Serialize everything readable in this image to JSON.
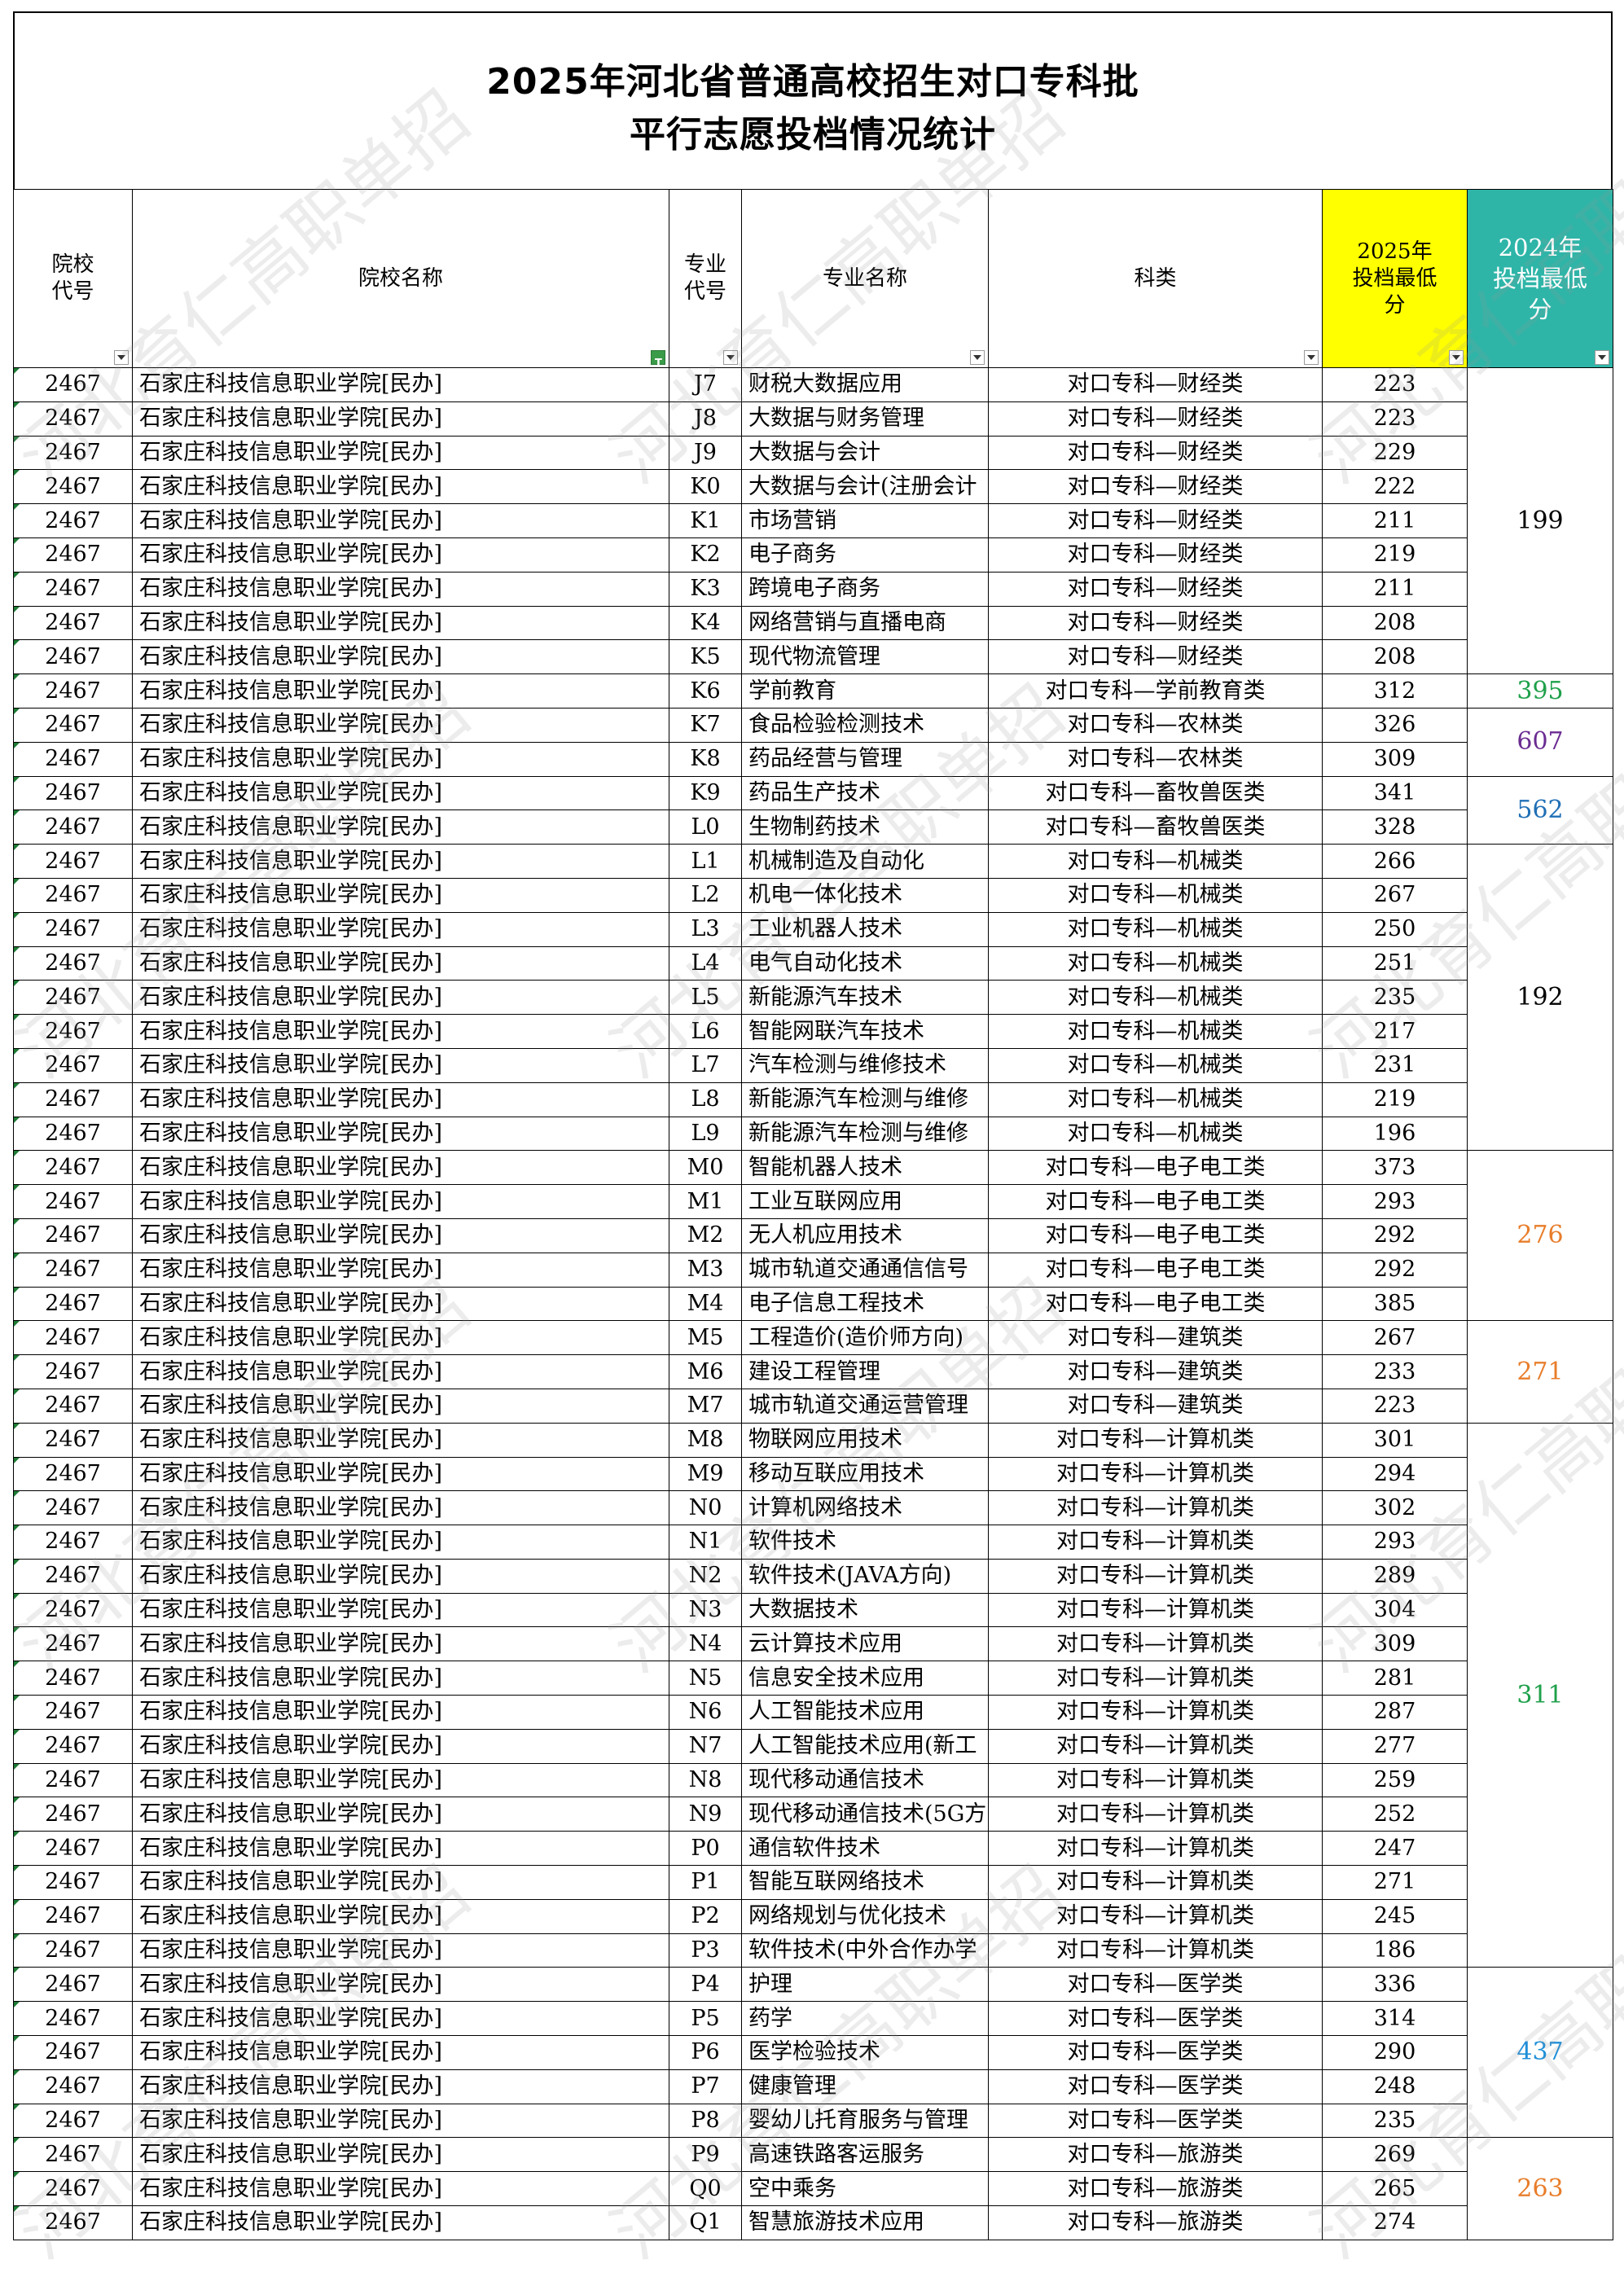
{
  "title": {
    "line1": "2025年河北省普通高校招生对口专科批",
    "line2": "平行志愿投档情况统计"
  },
  "columns": {
    "school_code": "院校代号",
    "school_name": "院校名称",
    "major_code": "专业代号",
    "major_name": "专业名称",
    "category": "科类",
    "score_2025": "2025年投档最低分",
    "score_2024": "2024年投档最低分"
  },
  "watermark": "河北育仁高职单招",
  "school": {
    "code": "2467",
    "name": "石家庄科技信息职业学院[民办]"
  },
  "rows": [
    {
      "mc": "J7",
      "mn": "财税大数据应用",
      "cat": "对口专科—财经类",
      "s": "223"
    },
    {
      "mc": "J8",
      "mn": "大数据与财务管理",
      "cat": "对口专科—财经类",
      "s": "223"
    },
    {
      "mc": "J9",
      "mn": "大数据与会计",
      "cat": "对口专科—财经类",
      "s": "229"
    },
    {
      "mc": "K0",
      "mn": "大数据与会计(注册会计",
      "cat": "对口专科—财经类",
      "s": "222"
    },
    {
      "mc": "K1",
      "mn": "市场营销",
      "cat": "对口专科—财经类",
      "s": "211"
    },
    {
      "mc": "K2",
      "mn": "电子商务",
      "cat": "对口专科—财经类",
      "s": "219"
    },
    {
      "mc": "K3",
      "mn": "跨境电子商务",
      "cat": "对口专科—财经类",
      "s": "211"
    },
    {
      "mc": "K4",
      "mn": "网络营销与直播电商",
      "cat": "对口专科—财经类",
      "s": "208"
    },
    {
      "mc": "K5",
      "mn": "现代物流管理",
      "cat": "对口专科—财经类",
      "s": "208"
    },
    {
      "mc": "K6",
      "mn": "学前教育",
      "cat": "对口专科—学前教育类",
      "s": "312"
    },
    {
      "mc": "K7",
      "mn": "食品检验检测技术",
      "cat": "对口专科—农林类",
      "s": "326"
    },
    {
      "mc": "K8",
      "mn": "药品经营与管理",
      "cat": "对口专科—农林类",
      "s": "309"
    },
    {
      "mc": "K9",
      "mn": "药品生产技术",
      "cat": "对口专科—畜牧兽医类",
      "s": "341"
    },
    {
      "mc": "L0",
      "mn": "生物制药技术",
      "cat": "对口专科—畜牧兽医类",
      "s": "328"
    },
    {
      "mc": "L1",
      "mn": "机械制造及自动化",
      "cat": "对口专科—机械类",
      "s": "266"
    },
    {
      "mc": "L2",
      "mn": "机电一体化技术",
      "cat": "对口专科—机械类",
      "s": "267"
    },
    {
      "mc": "L3",
      "mn": "工业机器人技术",
      "cat": "对口专科—机械类",
      "s": "250"
    },
    {
      "mc": "L4",
      "mn": "电气自动化技术",
      "cat": "对口专科—机械类",
      "s": "251"
    },
    {
      "mc": "L5",
      "mn": "新能源汽车技术",
      "cat": "对口专科—机械类",
      "s": "235"
    },
    {
      "mc": "L6",
      "mn": "智能网联汽车技术",
      "cat": "对口专科—机械类",
      "s": "217"
    },
    {
      "mc": "L7",
      "mn": "汽车检测与维修技术",
      "cat": "对口专科—机械类",
      "s": "231"
    },
    {
      "mc": "L8",
      "mn": "新能源汽车检测与维修",
      "cat": "对口专科—机械类",
      "s": "219"
    },
    {
      "mc": "L9",
      "mn": "新能源汽车检测与维修",
      "cat": "对口专科—机械类",
      "s": "196"
    },
    {
      "mc": "M0",
      "mn": "智能机器人技术",
      "cat": "对口专科—电子电工类",
      "s": "373"
    },
    {
      "mc": "M1",
      "mn": "工业互联网应用",
      "cat": "对口专科—电子电工类",
      "s": "293"
    },
    {
      "mc": "M2",
      "mn": "无人机应用技术",
      "cat": "对口专科—电子电工类",
      "s": "292"
    },
    {
      "mc": "M3",
      "mn": "城市轨道交通通信信号",
      "cat": "对口专科—电子电工类",
      "s": "292"
    },
    {
      "mc": "M4",
      "mn": "电子信息工程技术",
      "cat": "对口专科—电子电工类",
      "s": "385"
    },
    {
      "mc": "M5",
      "mn": "工程造价(造价师方向)",
      "cat": "对口专科—建筑类",
      "s": "267"
    },
    {
      "mc": "M6",
      "mn": "建设工程管理",
      "cat": "对口专科—建筑类",
      "s": "233"
    },
    {
      "mc": "M7",
      "mn": "城市轨道交通运营管理",
      "cat": "对口专科—建筑类",
      "s": "223"
    },
    {
      "mc": "M8",
      "mn": "物联网应用技术",
      "cat": "对口专科—计算机类",
      "s": "301"
    },
    {
      "mc": "M9",
      "mn": "移动互联应用技术",
      "cat": "对口专科—计算机类",
      "s": "294"
    },
    {
      "mc": "N0",
      "mn": "计算机网络技术",
      "cat": "对口专科—计算机类",
      "s": "302"
    },
    {
      "mc": "N1",
      "mn": "软件技术",
      "cat": "对口专科—计算机类",
      "s": "293"
    },
    {
      "mc": "N2",
      "mn": "软件技术(JAVA方向)",
      "cat": "对口专科—计算机类",
      "s": "289"
    },
    {
      "mc": "N3",
      "mn": "大数据技术",
      "cat": "对口专科—计算机类",
      "s": "304"
    },
    {
      "mc": "N4",
      "mn": "云计算技术应用",
      "cat": "对口专科—计算机类",
      "s": "309"
    },
    {
      "mc": "N5",
      "mn": "信息安全技术应用",
      "cat": "对口专科—计算机类",
      "s": "281"
    },
    {
      "mc": "N6",
      "mn": "人工智能技术应用",
      "cat": "对口专科—计算机类",
      "s": "287"
    },
    {
      "mc": "N7",
      "mn": "人工智能技术应用(新工",
      "cat": "对口专科—计算机类",
      "s": "277"
    },
    {
      "mc": "N8",
      "mn": "现代移动通信技术",
      "cat": "对口专科—计算机类",
      "s": "259"
    },
    {
      "mc": "N9",
      "mn": "现代移动通信技术(5G方",
      "cat": "对口专科—计算机类",
      "s": "252"
    },
    {
      "mc": "P0",
      "mn": "通信软件技术",
      "cat": "对口专科—计算机类",
      "s": "247"
    },
    {
      "mc": "P1",
      "mn": "智能互联网络技术",
      "cat": "对口专科—计算机类",
      "s": "271"
    },
    {
      "mc": "P2",
      "mn": "网络规划与优化技术",
      "cat": "对口专科—计算机类",
      "s": "245"
    },
    {
      "mc": "P3",
      "mn": "软件技术(中外合作办学",
      "cat": "对口专科—计算机类",
      "s": "186"
    },
    {
      "mc": "P4",
      "mn": "护理",
      "cat": "对口专科—医学类",
      "s": "336"
    },
    {
      "mc": "P5",
      "mn": "药学",
      "cat": "对口专科—医学类",
      "s": "314"
    },
    {
      "mc": "P6",
      "mn": "医学检验技术",
      "cat": "对口专科—医学类",
      "s": "290"
    },
    {
      "mc": "P7",
      "mn": "健康管理",
      "cat": "对口专科—医学类",
      "s": "248"
    },
    {
      "mc": "P8",
      "mn": "婴幼儿托育服务与管理",
      "cat": "对口专科—医学类",
      "s": "235"
    },
    {
      "mc": "P9",
      "mn": "高速铁路客运服务",
      "cat": "对口专科—旅游类",
      "s": "269"
    },
    {
      "mc": "Q0",
      "mn": "空中乘务",
      "cat": "对口专科—旅游类",
      "s": "265"
    },
    {
      "mc": "Q1",
      "mn": "智慧旅游技术应用",
      "cat": "对口专科—旅游类",
      "s": "274"
    }
  ],
  "score_2024_groups": [
    {
      "rows": 9,
      "value": "199",
      "color": "#000000"
    },
    {
      "rows": 1,
      "value": "395",
      "color": "#1fa04a"
    },
    {
      "rows": 2,
      "value": "607",
      "color": "#6a2c91"
    },
    {
      "rows": 2,
      "value": "562",
      "color": "#1f6fb5"
    },
    {
      "rows": 9,
      "value": "192",
      "color": "#000000"
    },
    {
      "rows": 5,
      "value": "276",
      "color": "#e87d2a"
    },
    {
      "rows": 3,
      "value": "271",
      "color": "#e87d2a"
    },
    {
      "rows": 16,
      "value": "311",
      "color": "#1fa04a"
    },
    {
      "rows": 5,
      "value": "437",
      "color": "#1f8fd8"
    },
    {
      "rows": 3,
      "value": "263",
      "color": "#e87d2a"
    }
  ]
}
